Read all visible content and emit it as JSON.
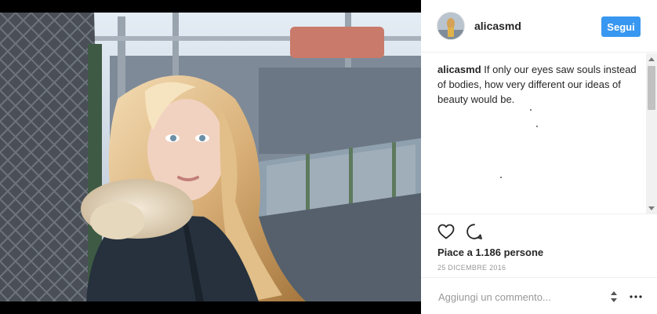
{
  "post": {
    "username": "alicasmd",
    "follow_label": "Segui",
    "caption_user": "alicasmd",
    "caption_text": "If only our eyes saw souls instead of bodies, how very different our ideas of beauty would be.",
    "likes": "Piace a 1.186 persone",
    "date": "25 DICEMBRE 2016",
    "comment_placeholder": "Aggiungi un commento..."
  },
  "icons": {
    "like": "heart-icon",
    "comment": "comment-icon",
    "stepper": "up-down-arrows-icon",
    "more": "more-options-icon"
  },
  "colors": {
    "follow_button": "#3897f0",
    "text": "#262626",
    "muted": "#999999"
  }
}
